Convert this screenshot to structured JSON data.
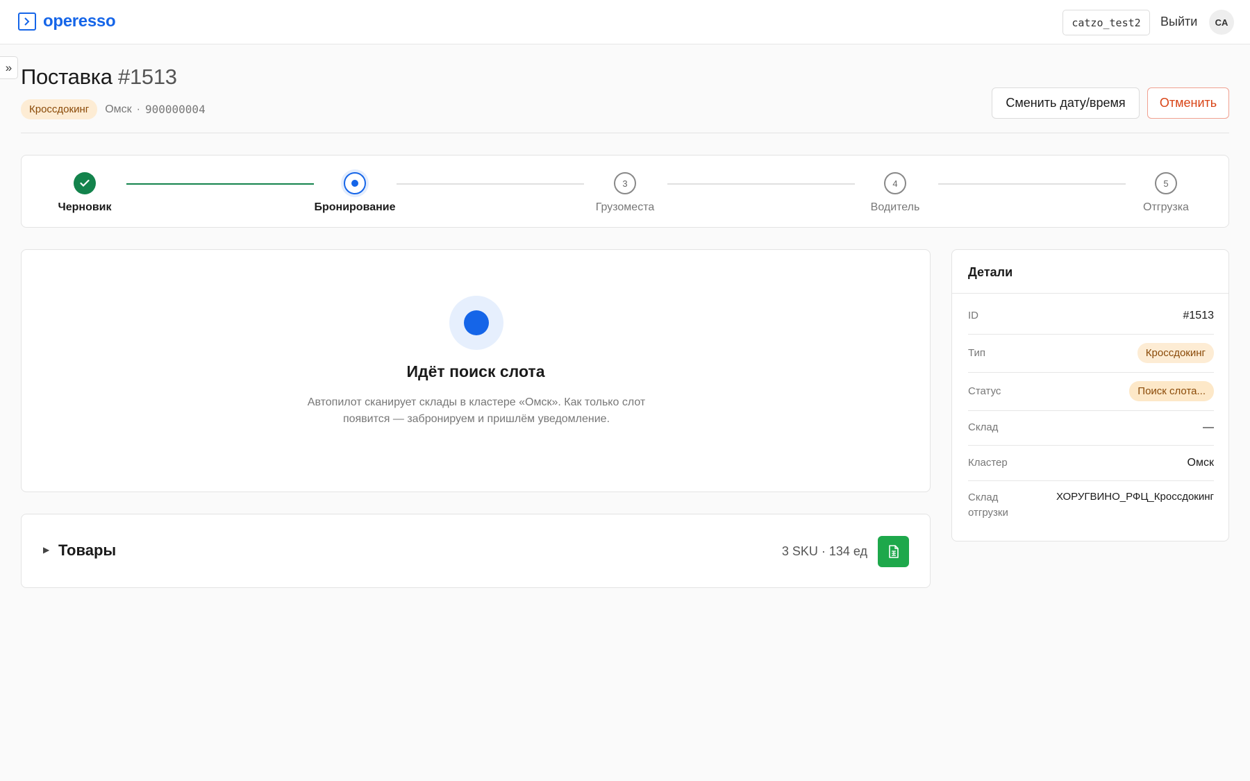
{
  "header": {
    "logo_text": "operesso",
    "username": "catzo_test2",
    "logout_label": "Выйти",
    "avatar_initials": "CA",
    "sidebar_toggle": "»"
  },
  "page": {
    "title": "Поставка",
    "number": "#1513",
    "type_badge": "Кроссдокинг",
    "city": "Омск",
    "separator": "·",
    "code": "900000004",
    "change_button": "Сменить дату/время",
    "cancel_button": "Отменить"
  },
  "stepper": {
    "steps": [
      {
        "label": "Черновик",
        "state": "done",
        "number": "1"
      },
      {
        "label": "Бронирование",
        "state": "active",
        "number": "2"
      },
      {
        "label": "Грузоместа",
        "state": "todo",
        "number": "3"
      },
      {
        "label": "Водитель",
        "state": "todo",
        "number": "4"
      },
      {
        "label": "Отгрузка",
        "state": "todo",
        "number": "5"
      }
    ]
  },
  "search": {
    "title": "Идёт поиск слота",
    "description": "Автопилот сканирует склады в кластере «Омск». Как только слот появится — забронируем и пришлём уведомление."
  },
  "goods": {
    "title": "Товары",
    "summary": "3 SKU · 134 ед",
    "export_icon": "spreadsheet-icon"
  },
  "details": {
    "title": "Детали",
    "rows": [
      {
        "label": "ID",
        "value": "#1513",
        "kind": "text"
      },
      {
        "label": "Тип",
        "value": "Кроссдокинг",
        "kind": "badge"
      },
      {
        "label": "Статус",
        "value": "Поиск слота...",
        "kind": "badge"
      },
      {
        "label": "Склад",
        "value": "—",
        "kind": "text"
      },
      {
        "label": "Кластер",
        "value": "Омск",
        "kind": "text"
      },
      {
        "label": "Склад отгрузки",
        "value": "ХОРУГВИНО_РФЦ_Кроссдокинг",
        "kind": "text"
      }
    ]
  },
  "colors": {
    "brand": "#1565e8",
    "success": "#13834c",
    "danger": "#d84315",
    "badge_bg": "#fdecd4",
    "excel": "#1ea84b"
  }
}
